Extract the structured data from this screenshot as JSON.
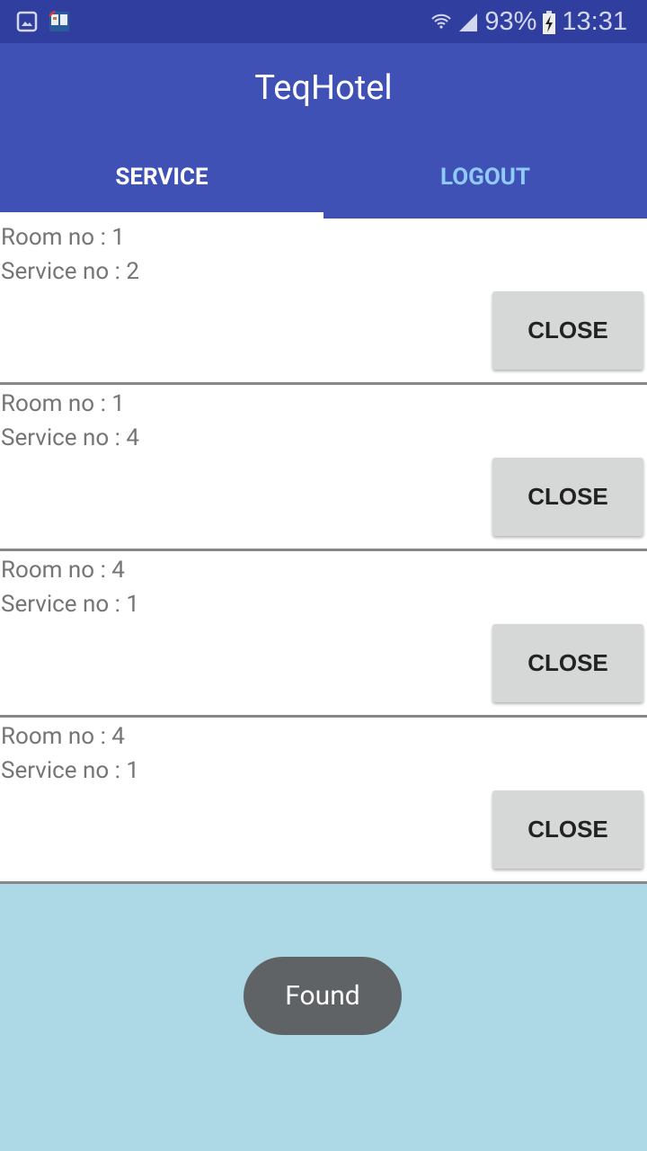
{
  "status_bar": {
    "left_icons": [
      "gallery-icon",
      "book-app-icon"
    ],
    "battery": "93%",
    "time": "13:31",
    "icons": [
      "wifi-icon",
      "signal-icon",
      "battery-charging-icon"
    ]
  },
  "app": {
    "title": "TeqHotel"
  },
  "tabs": [
    {
      "label": "SERVICE",
      "active": true
    },
    {
      "label": "LOGOUT",
      "active": false
    }
  ],
  "cards": [
    {
      "room": "Room no : 1",
      "service": "Service no : 2",
      "button": "CLOSE"
    },
    {
      "room": "Room no : 1",
      "service": "Service no : 4",
      "button": "CLOSE"
    },
    {
      "room": "Room no : 4",
      "service": "Service no : 1",
      "button": "CLOSE"
    },
    {
      "room": "Room no : 4",
      "service": "Service no : 1",
      "button": "CLOSE"
    }
  ],
  "toast": "Found",
  "colors": {
    "status": "#303f9f",
    "primary": "#3f51b5",
    "background": "#add8e6",
    "tab_inactive": "#90caf9"
  }
}
